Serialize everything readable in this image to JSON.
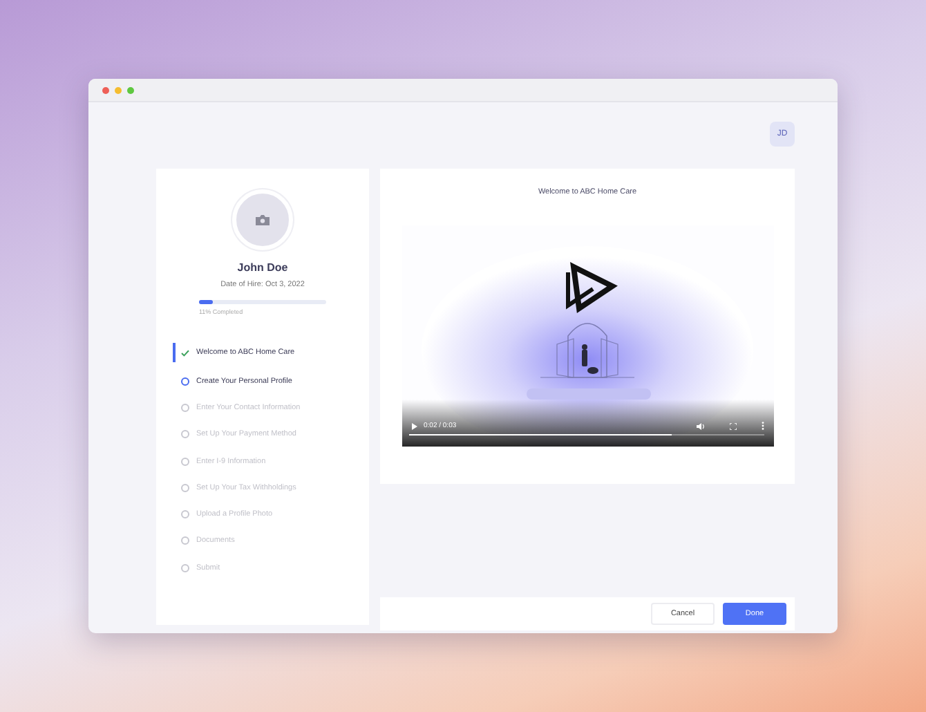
{
  "account": {
    "initials": "JD"
  },
  "profile": {
    "name": "John Doe",
    "hire_date": "Date of Hire: Oct 3, 2022",
    "progress": {
      "level": 0.11,
      "label": "11% Completed"
    }
  },
  "steps": [
    {
      "label": "Welcome to ABC Home Care",
      "completed": true,
      "available": true,
      "selected": true
    },
    {
      "label": "Create Your Personal Profile",
      "completed": false,
      "available": true,
      "selected": false
    },
    {
      "label": "Enter Your Contact Information",
      "completed": false,
      "available": false,
      "selected": false
    },
    {
      "label": "Set Up Your Payment Method",
      "completed": false,
      "available": false,
      "selected": false
    },
    {
      "label": "Enter I-9 Information",
      "completed": false,
      "available": false,
      "selected": false
    },
    {
      "label": "Set Up Your Tax Withholdings",
      "completed": false,
      "available": false,
      "selected": false
    },
    {
      "label": "Upload a Profile Photo",
      "completed": false,
      "available": false,
      "selected": false
    },
    {
      "label": "Documents",
      "completed": false,
      "available": false,
      "selected": false
    },
    {
      "label": "Submit",
      "completed": false,
      "available": false,
      "selected": false
    }
  ],
  "content": {
    "title": "Welcome to ABC Home Care",
    "video": {
      "kind": "picture",
      "time": "0:02 / 0:03",
      "level": 0.74
    }
  },
  "buttons": [
    {
      "label": "Cancel",
      "kind": "secondary"
    },
    {
      "label": "Done",
      "kind": "primary"
    }
  ]
}
